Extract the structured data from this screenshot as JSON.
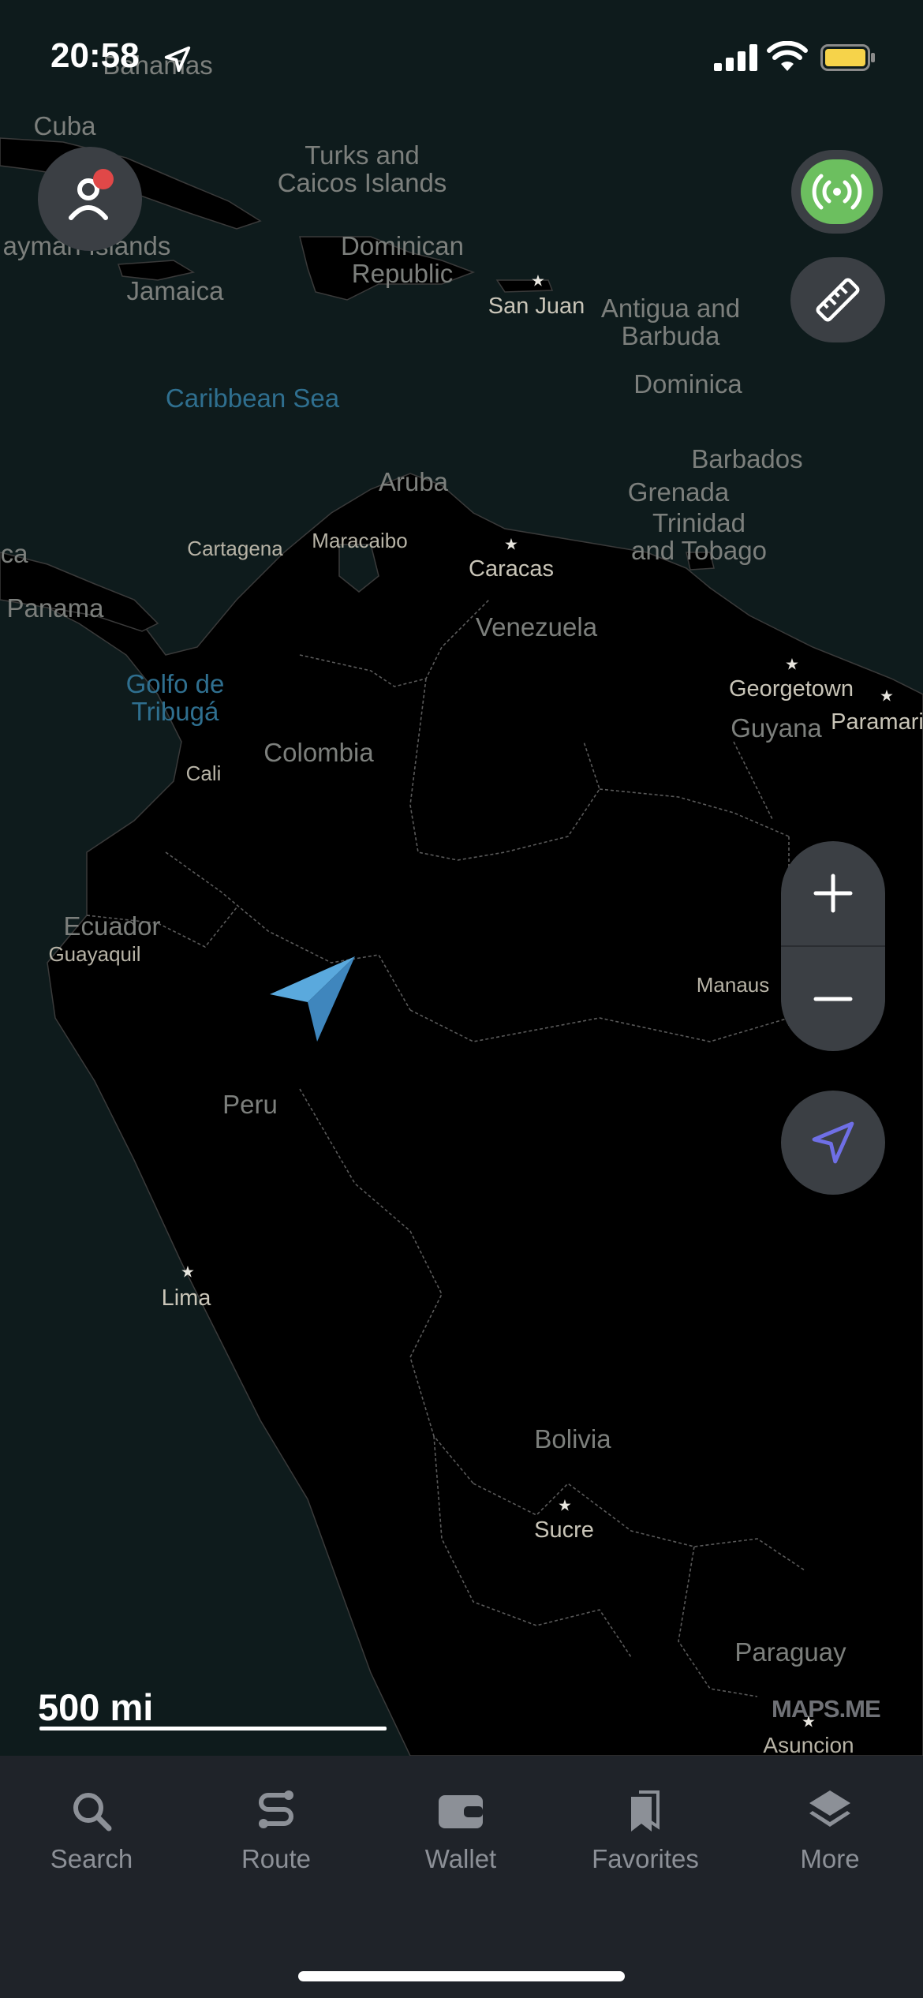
{
  "status_bar": {
    "time": "20:58"
  },
  "map": {
    "countries": [
      {
        "key": "cuba",
        "text": "Cuba"
      },
      {
        "key": "turks",
        "text": "Turks and\nCaicos Islands"
      },
      {
        "key": "cayman",
        "text": "ayman Islands"
      },
      {
        "key": "dominican",
        "text": "Dominican\nRepublic"
      },
      {
        "key": "jamaica",
        "text": "Jamaica"
      },
      {
        "key": "antigua",
        "text": "Antigua and\nBarbuda"
      },
      {
        "key": "dominica",
        "text": "Dominica"
      },
      {
        "key": "barbados",
        "text": "Barbados"
      },
      {
        "key": "grenada",
        "text": "Grenada"
      },
      {
        "key": "trinidad",
        "text": "Trinidad\nand Tobago"
      },
      {
        "key": "aruba",
        "text": "Aruba"
      },
      {
        "key": "ca",
        "text": "ca"
      },
      {
        "key": "panama",
        "text": "Panama"
      },
      {
        "key": "venezuela",
        "text": "Venezuela"
      },
      {
        "key": "colombia",
        "text": "Colombia"
      },
      {
        "key": "guyana",
        "text": "Guyana"
      },
      {
        "key": "ecuador",
        "text": "Ecuador"
      },
      {
        "key": "peru",
        "text": "Peru"
      },
      {
        "key": "bolivia",
        "text": "Bolivia"
      },
      {
        "key": "paraguay",
        "text": "Paraguay"
      },
      {
        "key": "bahamas",
        "text": "Bahamas"
      }
    ],
    "seas": [
      {
        "key": "caribbean",
        "text": "Caribbean Sea"
      },
      {
        "key": "golfo",
        "text": "Golfo de\nTribugá"
      }
    ],
    "cities": [
      {
        "key": "sanjuan",
        "text": "San Juan"
      },
      {
        "key": "cartagena",
        "text": "Cartagena"
      },
      {
        "key": "maracaibo",
        "text": "Maracaibo"
      },
      {
        "key": "caracas",
        "text": "Caracas"
      },
      {
        "key": "georgetown",
        "text": "Georgetown"
      },
      {
        "key": "paramaribo",
        "text": "Paramari"
      },
      {
        "key": "cali",
        "text": "Cali"
      },
      {
        "key": "guayaquil",
        "text": "Guayaquil"
      },
      {
        "key": "manaus",
        "text": "Manaus"
      },
      {
        "key": "lima",
        "text": "Lima"
      },
      {
        "key": "sucre",
        "text": "Sucre"
      },
      {
        "key": "asuncion",
        "text": "Asuncion"
      }
    ]
  },
  "scale": {
    "label": "500 mi"
  },
  "brand": "MAPS.ME",
  "tabs": [
    {
      "label": "Search",
      "icon": "search-icon"
    },
    {
      "label": "Route",
      "icon": "route-icon"
    },
    {
      "label": "Wallet",
      "icon": "wallet-icon"
    },
    {
      "label": "Favorites",
      "icon": "bookmark-icon"
    },
    {
      "label": "More",
      "icon": "layers-icon"
    }
  ],
  "colors": {
    "accent_green": "#6cbf5f",
    "location_arrow": "#5aa9dd",
    "my_position_icon": "#6f6fe6",
    "badge": "#e04848"
  }
}
